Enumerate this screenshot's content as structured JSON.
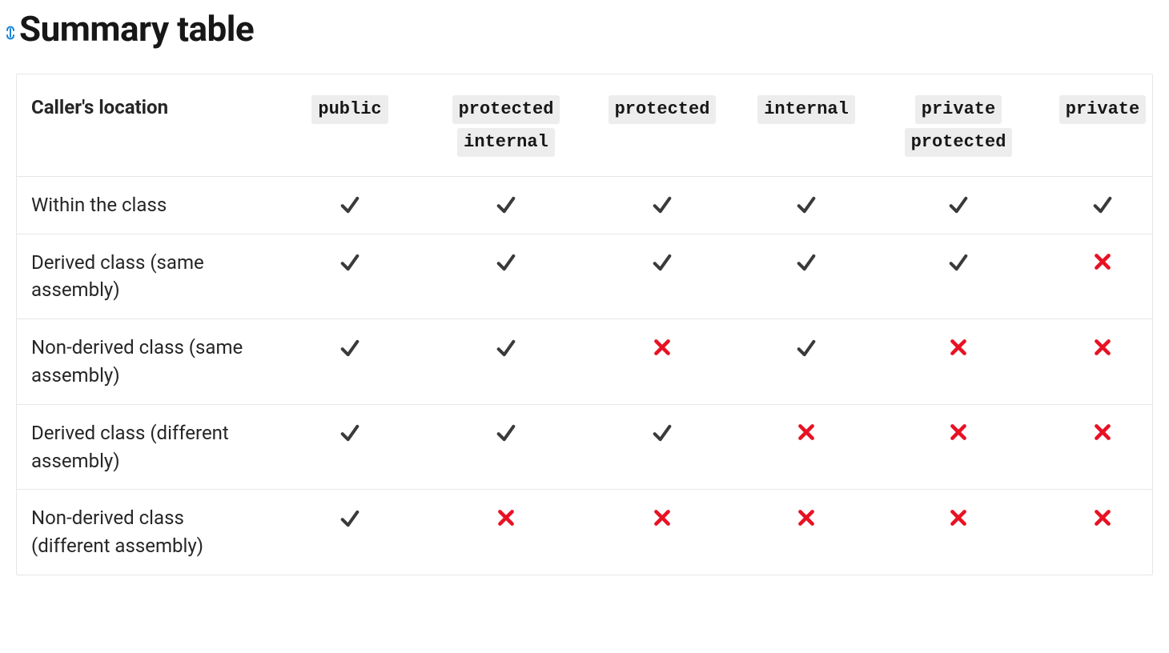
{
  "heading": "Summary table",
  "chart_data": {
    "type": "table",
    "title": "Summary table",
    "row_header_label": "Caller's location",
    "columns": [
      "public",
      "protected internal",
      "protected",
      "internal",
      "private protected",
      "private"
    ],
    "rows": [
      {
        "label": "Within the class",
        "values": [
          true,
          true,
          true,
          true,
          true,
          true
        ]
      },
      {
        "label": "Derived class (same assembly)",
        "values": [
          true,
          true,
          true,
          true,
          true,
          false
        ]
      },
      {
        "label": "Non-derived class (same assembly)",
        "values": [
          true,
          true,
          false,
          true,
          false,
          false
        ]
      },
      {
        "label": "Derived class (different assembly)",
        "values": [
          true,
          true,
          true,
          false,
          false,
          false
        ]
      },
      {
        "label": "Non-derived class (different assembly)",
        "values": [
          true,
          false,
          false,
          false,
          false,
          false
        ]
      }
    ]
  },
  "header": {
    "first": "Caller's location",
    "cols": [
      [
        "public"
      ],
      [
        "protected",
        "internal"
      ],
      [
        "protected"
      ],
      [
        "internal"
      ],
      [
        "private",
        "protected"
      ],
      [
        "private"
      ]
    ]
  },
  "rows": [
    {
      "label": "Within the class",
      "cells": [
        "check",
        "check",
        "check",
        "check",
        "check",
        "check"
      ]
    },
    {
      "label": "Derived class (same assembly)",
      "cells": [
        "check",
        "check",
        "check",
        "check",
        "check",
        "cross"
      ]
    },
    {
      "label": "Non-derived class (same assembly)",
      "cells": [
        "check",
        "check",
        "cross",
        "check",
        "cross",
        "cross"
      ]
    },
    {
      "label": "Derived class (different assembly)",
      "cells": [
        "check",
        "check",
        "check",
        "cross",
        "cross",
        "cross"
      ]
    },
    {
      "label": "Non-derived class (different assembly)",
      "cells": [
        "check",
        "cross",
        "cross",
        "cross",
        "cross",
        "cross"
      ]
    }
  ]
}
